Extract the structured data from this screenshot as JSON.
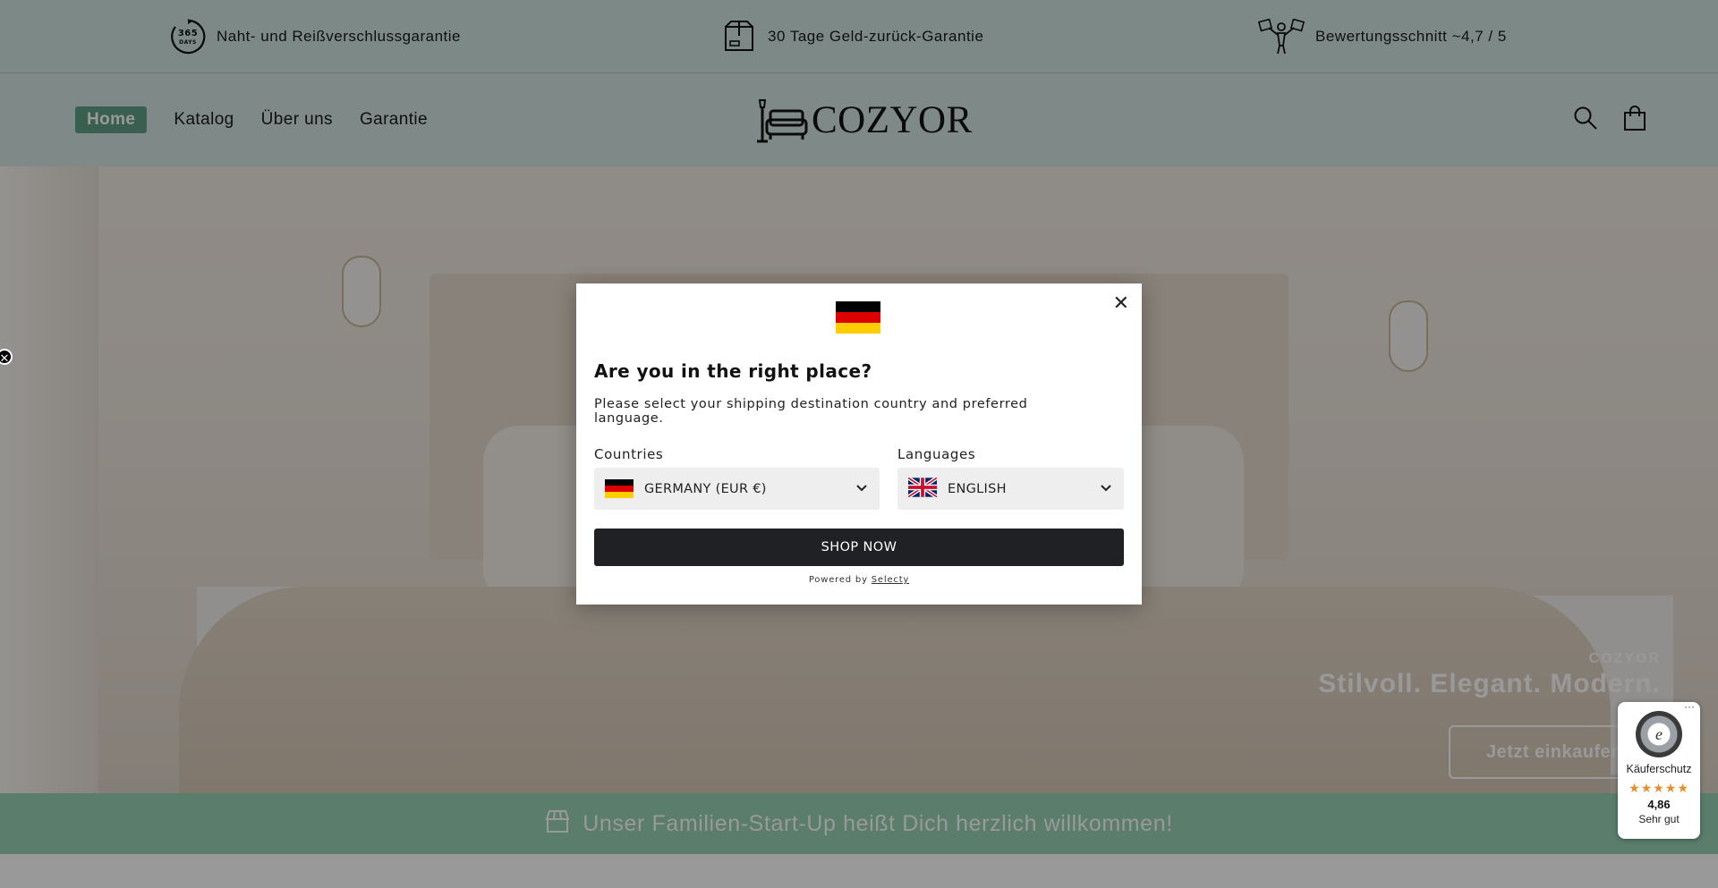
{
  "topbar": {
    "items": [
      {
        "icon": "365-days-icon",
        "icon_text": "365 DAYS",
        "label": "Naht- und Reißverschlussgarantie"
      },
      {
        "icon": "box-icon",
        "label": "30 Tage Geld-zurück-Garantie"
      },
      {
        "icon": "rating-icon",
        "label": "Bewertungsschnitt ~4,7 / 5"
      }
    ]
  },
  "nav": {
    "items": [
      "Home",
      "Katalog",
      "Über uns",
      "Garantie"
    ],
    "active": "Home"
  },
  "logo": {
    "text": "COZYOR"
  },
  "header_icons": [
    "search-icon",
    "cart-icon"
  ],
  "hero": {
    "brand": "COZYOR",
    "title": "Stilvoll. Elegant. Modern.",
    "button": "Jetzt einkaufen"
  },
  "welcome_bar": {
    "icon": "store-icon",
    "text": "Unser Familien-Start-Up heißt Dich herzlich willkommen!"
  },
  "side_close": {
    "symbol": "✕"
  },
  "modal": {
    "close": "✕",
    "title": "Are you in the right place?",
    "subtitle": "Please select your shipping destination country and preferred language.",
    "countries_label": "Countries",
    "country_value": "GERMANY (EUR €)",
    "languages_label": "Languages",
    "language_value": "ENGLISH",
    "button": "SHOP NOW",
    "powered_by": "Powered by",
    "powered_link": "Selecty"
  },
  "trust_badge": {
    "dots": "···",
    "seal_letter": "e",
    "label": "Käuferschutz",
    "stars": "★★★★★",
    "score": "4,86",
    "rating": "Sehr gut"
  },
  "colors": {
    "topbar_bg": "#cfe4e2",
    "nav_active": "#5f9e86",
    "welcome_bg": "#97d0b4",
    "shop_button": "#202124",
    "star": "#e88d2b",
    "flag_de": [
      "#000000",
      "#dd0000",
      "#ffce00"
    ]
  }
}
